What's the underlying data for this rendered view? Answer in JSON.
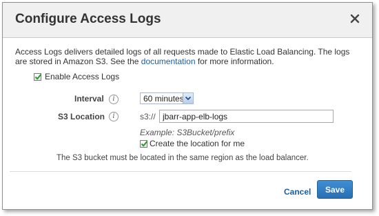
{
  "dialog": {
    "title": "Configure Access Logs",
    "description": {
      "before_link": "Access Logs delivers detailed logs of all requests made to Elastic Load Balancing. The logs are stored in Amazon S3. See the ",
      "link_text": "documentation",
      "after_link": " for more information."
    },
    "enable_checkbox": {
      "label": "Enable Access Logs",
      "checked": true
    },
    "interval": {
      "label": "Interval",
      "value": "60 minutes"
    },
    "s3_location": {
      "label": "S3 Location",
      "prefix": "s3://",
      "value": "jbarr-app-elb-logs",
      "example": "Example: S3Bucket/prefix"
    },
    "create_checkbox": {
      "label": "Create the location for me",
      "checked": true
    },
    "note": "The S3 bucket must be located in the same region as the load balancer.",
    "buttons": {
      "cancel": "Cancel",
      "save": "Save"
    }
  },
  "icons": {
    "close": "close-icon",
    "info": "info-icon",
    "checkmark": "checkmark-icon",
    "dropdown": "chevron-down-icon"
  },
  "colors": {
    "link": "#1a5ea8",
    "save_button": "#2f7bc3",
    "checkmark": "#2e9a2e"
  }
}
